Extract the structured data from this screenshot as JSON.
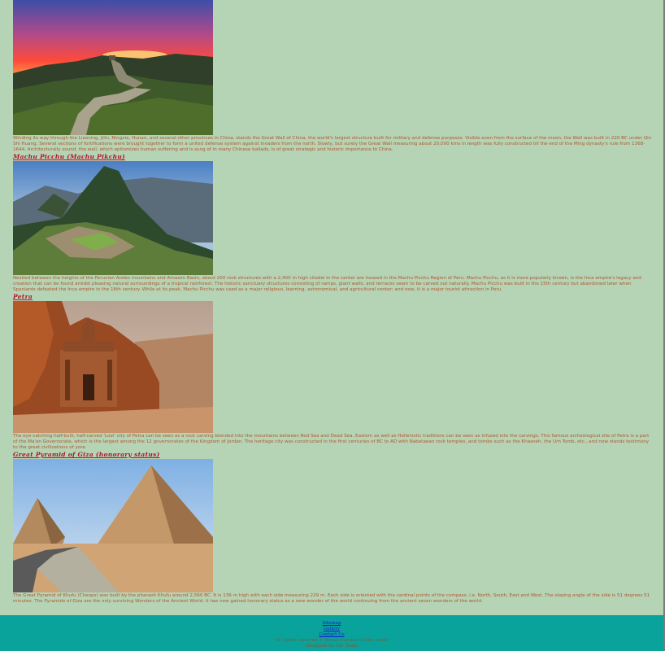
{
  "sections": [
    {
      "heading": "",
      "image_alt": "Great Wall of China at sunset",
      "description": "Winding its way through the Liaoning, Jilin, Ningxia, Hunan, and several other provinces in China, stands the Great Wall of China, the world's largest structure built for military and defense purposes. Visible even from the surface of the moon, the Wall was built in 220 BC under Qin Shi Huang. Several sections of fortifications were brought together to form a united defense system against invaders from the north. Slowly, but surely the Great Wall measuring about 20,000 kms in length was fully constructed till the end of the Ming dynasty's rule from 1368-1644. Architecturally sound, the wall, which epitomizes human suffering and is sung of in many Chinese ballads, is of great strategic and historic importance to China."
    },
    {
      "heading": "Machu Picchu (Machu Pikchu)",
      "image_alt": "Machu Picchu citadel",
      "description": "Nestled between the heights of the Peruvian Andes mountains and Amazon Basin, about 200 rock structures with a 2,400 m high citadel in the center are housed in the Machu Picchu Region of Peru. Machu Picchu, as it is more popularly known, is the Inca empire's legacy and creation that can be found amidst pleasing natural surroundings of a tropical rainforest. The historic sanctuary structures consisting of ramps, giant walls, and terraces seem to be carved out naturally. Machu Picchu was built in the 15th century but abandoned later when Spaniards defeated the Inca empire in the 16th century. While at its peak, Machu Picchu was used as a major religious, learning, astronomical, and agricultural center; and now, it is a major tourist attraction in Peru."
    },
    {
      "heading": "Petra",
      "image_alt": "Petra rock carving",
      "description": "The eye-catching half-built, half-carved 'Lost' city of Petra can be seen as a rock carving blended into the mountains between Red Sea and Dead Sea. Eastern as well as Hellenistic traditions can be seen as infused into the carvings. This famous archeological site of Petra is a part of the Ma'an Governorate, which is the largest among the 12 governorates of the Kingdom of Jordan. The heritage city was constructed in the first centuries of BC to AD with Nabataean rock temples, and tombs such as the Khasneh, the Urn Tomb, etc., and now stands testimony to the great civilizations of yore."
    },
    {
      "heading": "Great Pyramid of Giza (honorary status)",
      "image_alt": "Pyramids of Giza",
      "description": "The Great Pyramid of Khufu (Cheops) was built by the pharaoh Khufu around 2,560 BC. It is 136 m high with each side measuring 229 m. Each side is oriented with the cardinal points of the compass, i.e. North, South, East and West. The sloping angle of the side is 51 degrees 51 minutes. The Pyramids of Giza are the only surviving Wonders of the Ancient World. It has now gained honorary status as a new wonder of the world continuing from the ancient seven wonders of the world."
    }
  ],
  "footer": {
    "links": [
      "Sitemap",
      "Gallery",
      "Contact Us"
    ],
    "copyright": "All rights reserved ©  Seven wonders of the world",
    "designer": "Designed by Abc Team"
  }
}
